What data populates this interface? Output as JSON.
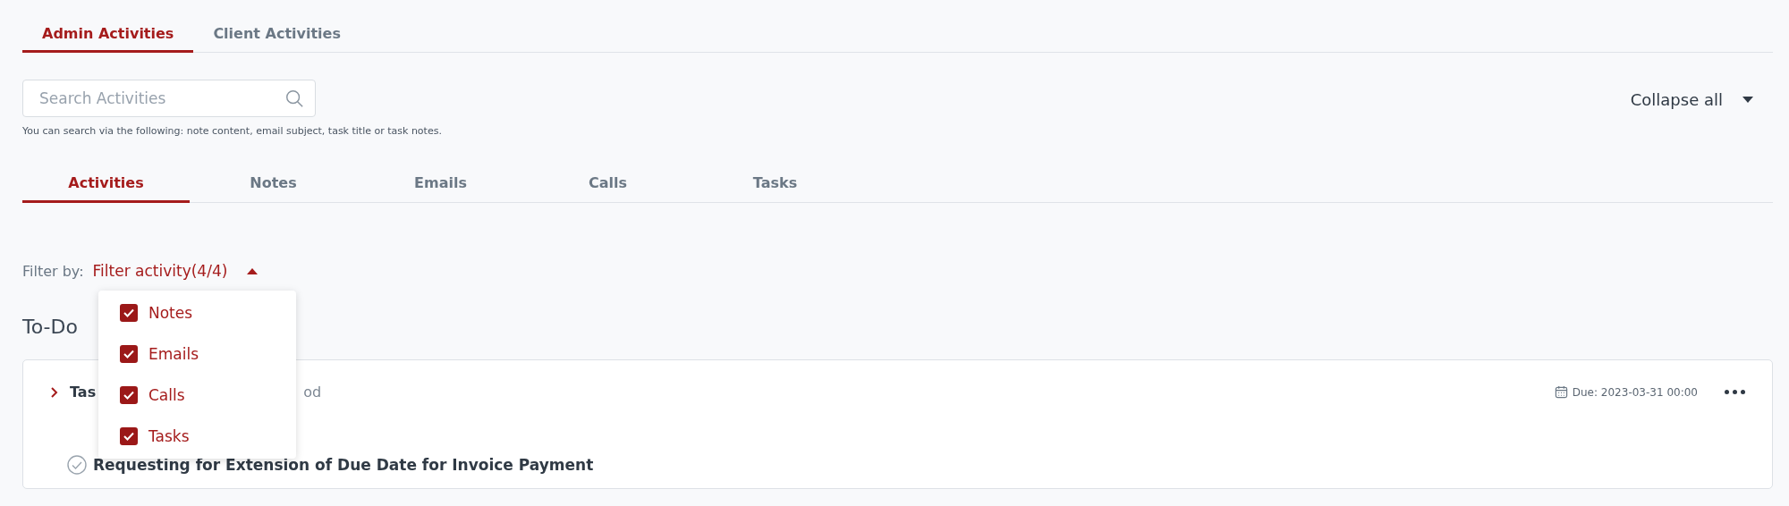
{
  "top_tabs": [
    {
      "label": "Admin Activities",
      "selected": true
    },
    {
      "label": "Client Activities",
      "selected": false
    }
  ],
  "search": {
    "placeholder": "Search Activities",
    "hint": "You can search via the following: note content, email subject, task title or task notes."
  },
  "collapse": {
    "label": "Collapse all"
  },
  "activity_tabs": [
    {
      "label": "Activities",
      "selected": true
    },
    {
      "label": "Notes",
      "selected": false
    },
    {
      "label": "Emails",
      "selected": false
    },
    {
      "label": "Calls",
      "selected": false
    },
    {
      "label": "Tasks",
      "selected": false
    }
  ],
  "filter": {
    "label": "Filter by:",
    "value": "Filter activity(4/4)",
    "expanded": true,
    "options": [
      {
        "label": "Notes",
        "checked": true
      },
      {
        "label": "Emails",
        "checked": true
      },
      {
        "label": "Calls",
        "checked": true
      },
      {
        "label": "Tasks",
        "checked": true
      }
    ]
  },
  "section_title": "To-Do",
  "task": {
    "title_start": "Tas",
    "title_end": "od",
    "due": "Due: 2023-03-31 00:00",
    "subject": "Requesting for Extension of Due Date for Invoice Payment",
    "completed": false
  }
}
